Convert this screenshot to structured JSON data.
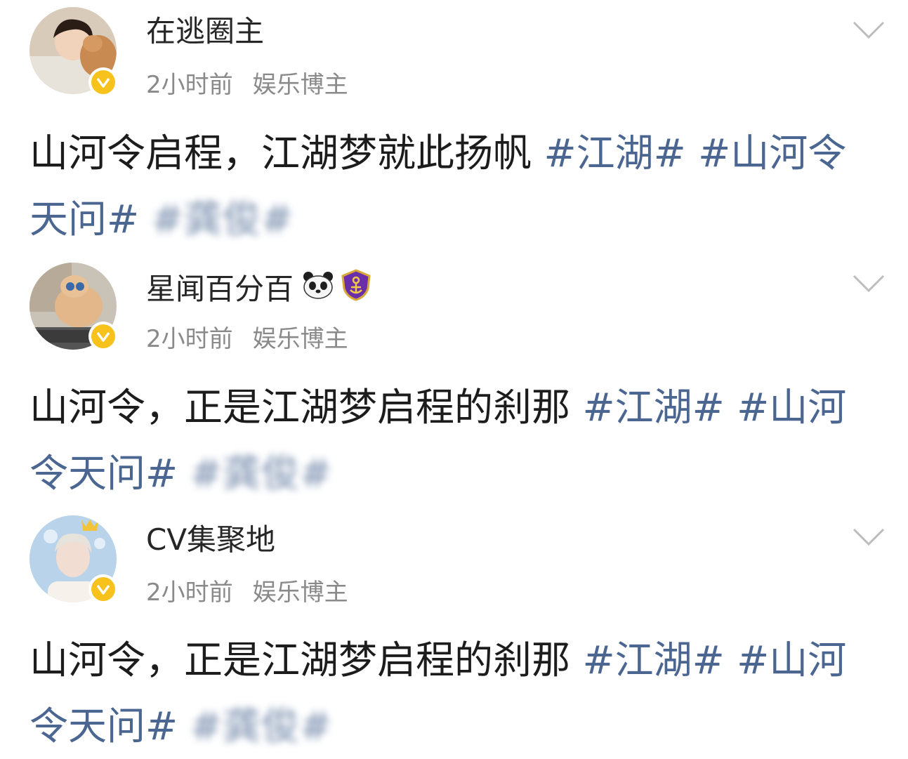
{
  "posts": [
    {
      "username": "在逃圈主",
      "time": "2小时前",
      "category": "娱乐博主",
      "text": "山河令启程，江湖梦就此扬帆 ",
      "tags": [
        "#江湖# ",
        "#山河令天问# ",
        "#龚俊#"
      ],
      "badges": []
    },
    {
      "username": "星闻百分百",
      "time": "2小时前",
      "category": "娱乐博主",
      "text": "山河令，正是江湖梦启程的刹那 ",
      "tags": [
        "#江湖# ",
        "#山河令天问# ",
        "#龚俊#"
      ],
      "badges": [
        "panda-icon",
        "shield-badge-icon"
      ]
    },
    {
      "username": "CV集聚地",
      "time": "2小时前",
      "category": "娱乐博主",
      "text": "山河令，正是江湖梦启程的刹那 ",
      "tags": [
        "#江湖# ",
        "#山河令天问# ",
        "#龚俊#"
      ],
      "badges": []
    }
  ],
  "colors": {
    "tag": "#4a6691",
    "meta": "#8a8a8a",
    "verified": "#f6c21b"
  }
}
